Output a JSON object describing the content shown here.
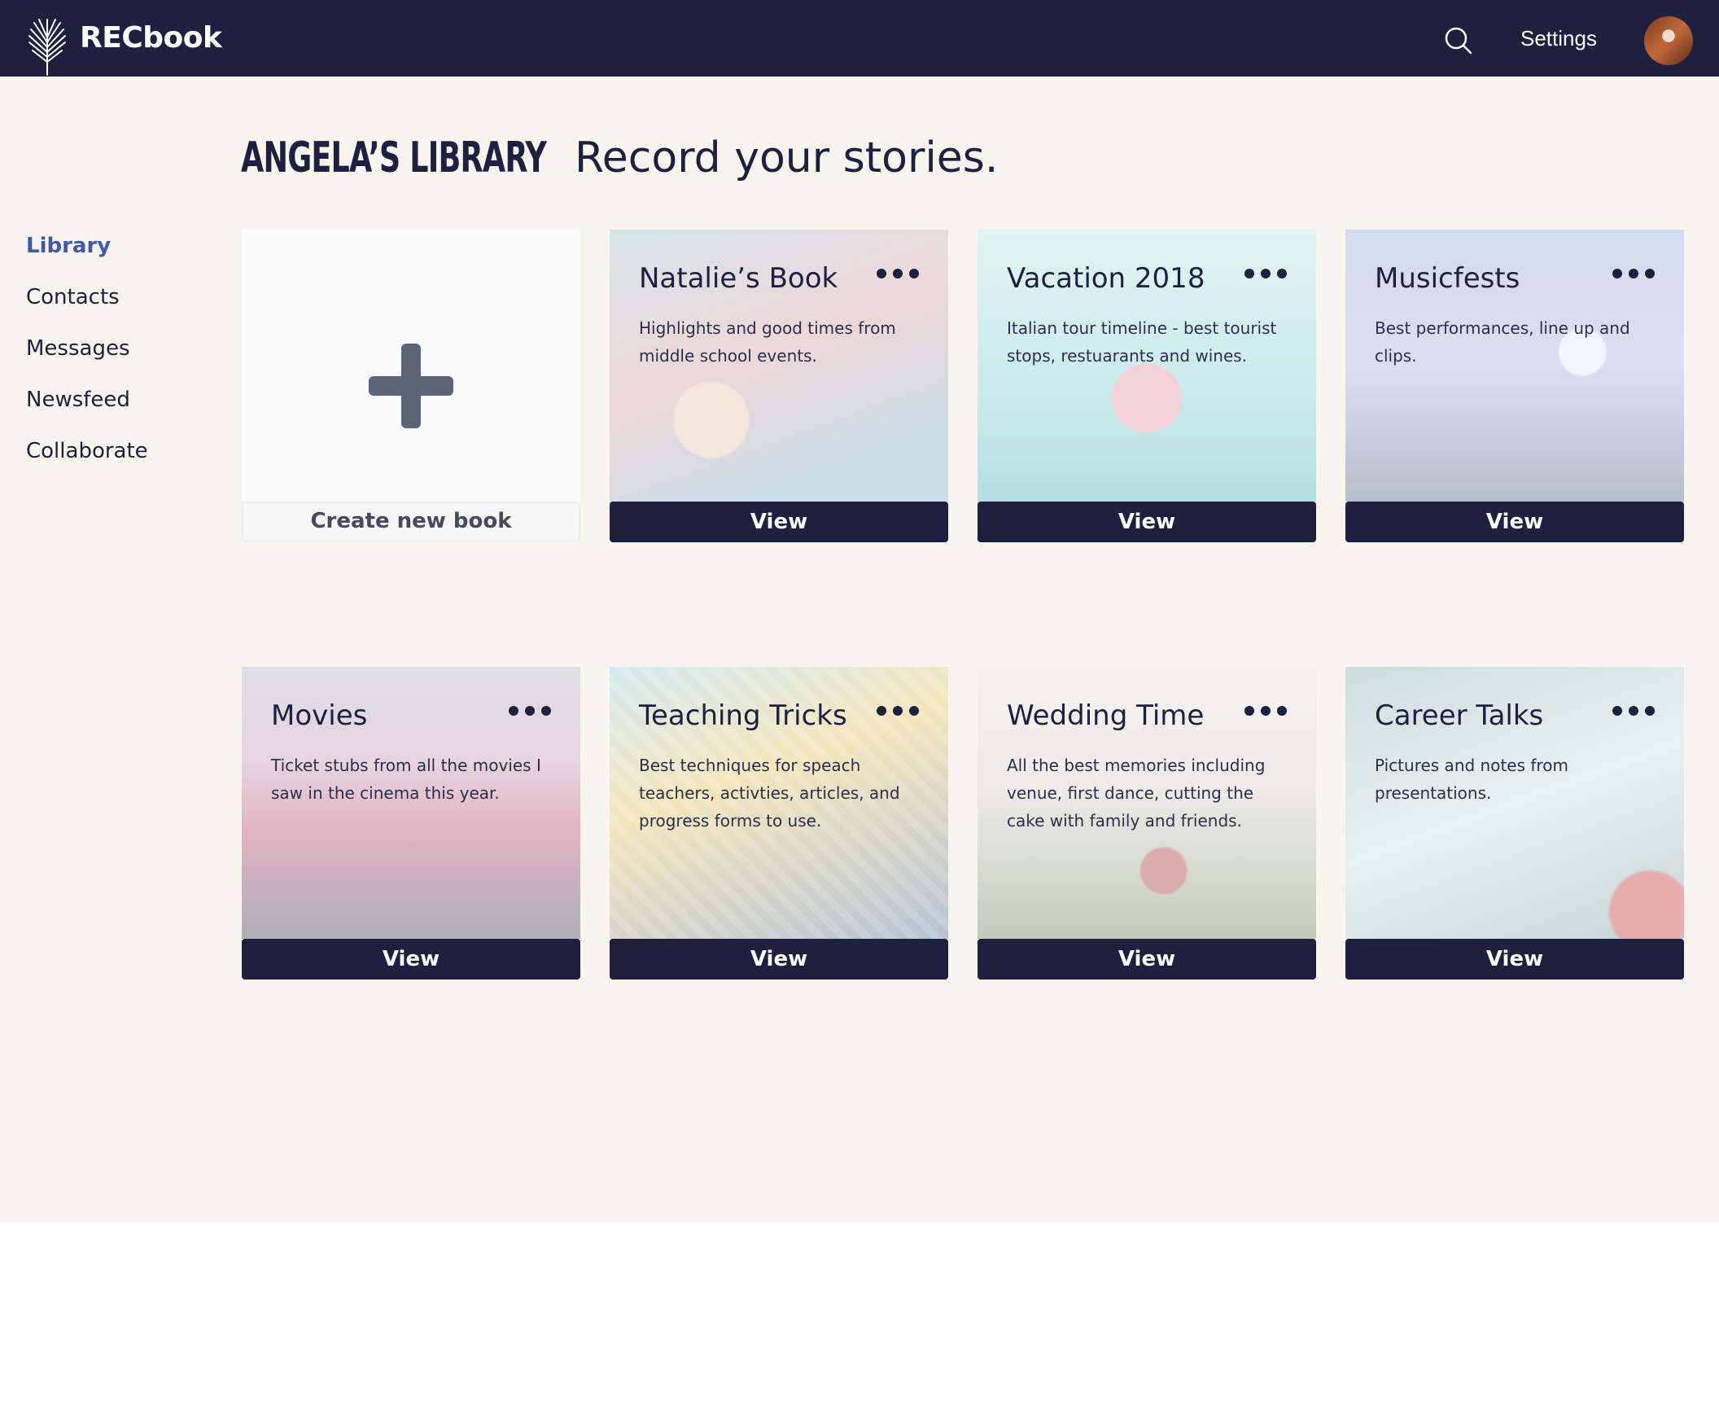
{
  "app": {
    "name": "RECbook",
    "logo_icon": "palm-leaf-icon"
  },
  "header": {
    "search_icon": "search-icon",
    "settings_label": "Settings",
    "avatar_alt": "user avatar"
  },
  "page": {
    "title": "ANGELA’S LIBRARY",
    "subtitle": "Record your stories."
  },
  "sidebar": {
    "items": [
      {
        "label": "Library",
        "active": true
      },
      {
        "label": "Contacts"
      },
      {
        "label": "Messages"
      },
      {
        "label": "Newsfeed"
      },
      {
        "label": "Collaborate"
      }
    ]
  },
  "create": {
    "label": "Create new book",
    "icon": "plus-icon"
  },
  "books": [
    {
      "title": "Natalie’s Book",
      "description": "Highlights and good times from middle school events.",
      "button": "View",
      "tint": "#c7dbe4"
    },
    {
      "title": "Vacation 2018",
      "description": "Italian tour timeline - best tourist stops, restuarants and wines.",
      "button": "View",
      "tint": "#b9e3e3"
    },
    {
      "title": "Musicfests",
      "description": "Best performances, line up and clips.",
      "button": "View",
      "tint": "#b8c8de"
    },
    {
      "title": "Movies",
      "description": "Ticket stubs from all the movies I saw in the cinema this year.",
      "button": "View",
      "tint": "#d9c3cf"
    },
    {
      "title": "Teaching Tricks",
      "description": "Best techniques for speach teachers, activties, articles, and progress forms to use.",
      "button": "View",
      "tint": "#c2dde3"
    },
    {
      "title": "Wedding Time",
      "description": "All the best memories including venue, first dance, cutting the cake with family and friends.",
      "button": "View",
      "tint": "#e0dcd8"
    },
    {
      "title": "Career Talks",
      "description": "Pictures and notes from presentations.",
      "button": "View",
      "tint": "#bcd3d5"
    }
  ],
  "colors": {
    "navy": "#1d203f",
    "accent": "#3f5aa2",
    "background": "#f8f5ef"
  }
}
